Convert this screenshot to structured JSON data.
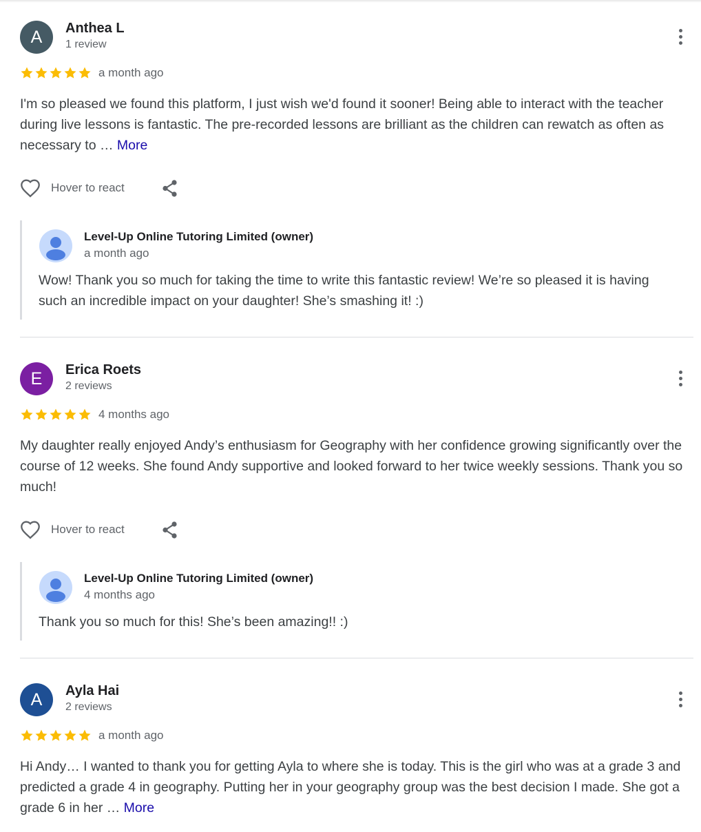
{
  "colors": {
    "star": "#fbbc04",
    "link": "#1a0dab",
    "avatar_anthea": "#455a64",
    "avatar_erica": "#7b1fa2",
    "avatar_ayla": "#1e4f94"
  },
  "reviews": [
    {
      "initial": "A",
      "author": "Anthea L",
      "review_count": "1 review",
      "rating": 5,
      "time": "a month ago",
      "text": "I'm so pleased we found this platform, I just wish we'd found it sooner! Being able to interact with the teacher during live lessons is fantastic. The pre-recorded lessons are brilliant as the children can rewatch as often as necessary to … ",
      "more_label": "More",
      "react_label": "Hover to react",
      "owner_reply": {
        "name": "Level-Up Online Tutoring Limited (owner)",
        "time": "a month ago",
        "text": "Wow! Thank you so much for taking the time to write this fantastic review! We’re so pleased it is having such an incredible impact on your daughter! She’s smashing it! :)"
      }
    },
    {
      "initial": "E",
      "author": "Erica Roets",
      "review_count": "2 reviews",
      "rating": 5,
      "time": "4 months ago",
      "text": "My daughter really enjoyed Andy’s enthusiasm for Geography with her confidence growing significantly over the course of 12 weeks. She found Andy supportive and looked forward to her twice weekly sessions. Thank you so much!",
      "react_label": "Hover to react",
      "owner_reply": {
        "name": "Level-Up Online Tutoring Limited (owner)",
        "time": "4 months ago",
        "text": "Thank you so much for this! She’s been amazing!! :)"
      }
    },
    {
      "initial": "A",
      "author": "Ayla Hai",
      "review_count": "2 reviews",
      "rating": 5,
      "time": "a month ago",
      "text": "Hi Andy… I wanted to thank you for getting Ayla to where she is today. This is the girl who was at a grade 3 and predicted a grade 4 in geography. Putting her in your geography group was the best decision I made. She got a grade 6 in her … ",
      "more_label": "More"
    }
  ]
}
